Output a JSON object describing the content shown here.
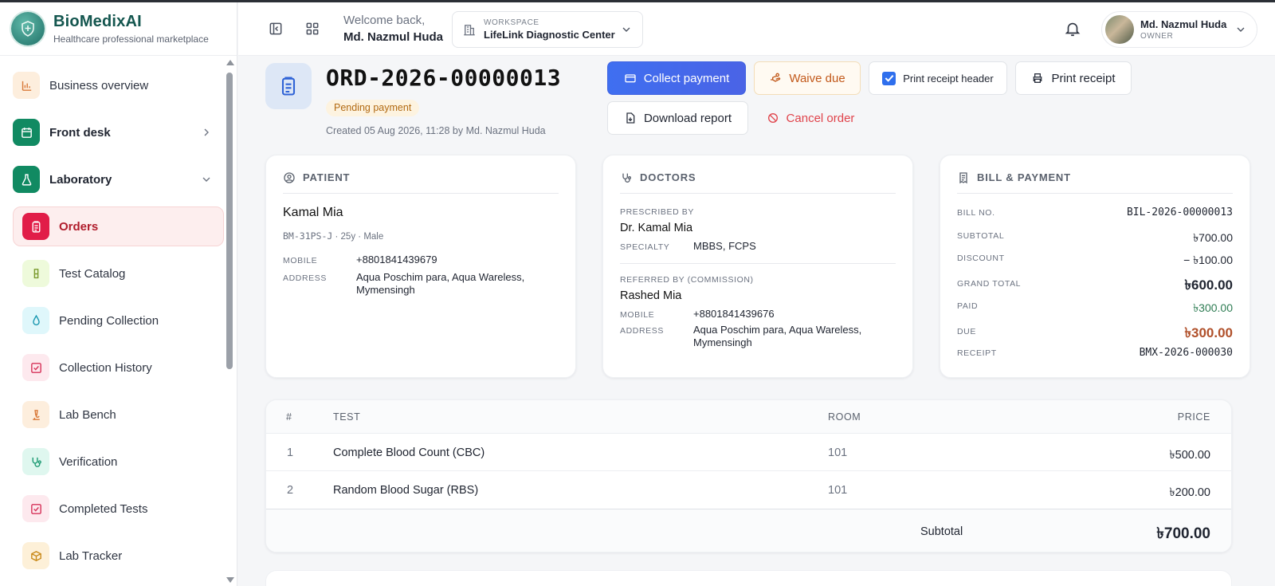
{
  "brand": {
    "title": "BioMedixAI",
    "subtitle": "Healthcare professional marketplace"
  },
  "sidebar": {
    "items": [
      {
        "label": "Business overview",
        "icon": "bar-chart-icon",
        "color": "#fdeedd"
      },
      {
        "label": "Front desk",
        "icon": "calendar-icon",
        "color": "#118a62"
      },
      {
        "label": "Laboratory",
        "icon": "flask-icon",
        "color": "#118a62"
      },
      {
        "label": "Orders",
        "icon": "clipboard-icon",
        "color": "#e11d48"
      },
      {
        "label": "Test Catalog",
        "icon": "test-tube-icon",
        "color": "#eefadb"
      },
      {
        "label": "Pending Collection",
        "icon": "droplet-icon",
        "color": "#dff7fb"
      },
      {
        "label": "Collection History",
        "icon": "checklist-icon",
        "color": "#fde9ee"
      },
      {
        "label": "Lab Bench",
        "icon": "microscope-icon",
        "color": "#fdeedd"
      },
      {
        "label": "Verification",
        "icon": "stethoscope-icon",
        "color": "#dff7ef"
      },
      {
        "label": "Completed Tests",
        "icon": "check-square-icon",
        "color": "#fde9ee"
      },
      {
        "label": "Lab Tracker",
        "icon": "box-icon",
        "color": "#fdf0d8"
      }
    ]
  },
  "header": {
    "welcome": "Welcome back,",
    "user_name": "Md. Nazmul Huda",
    "workspace_label": "WORKSPACE",
    "workspace_name": "LifeLink Diagnostic Center",
    "profile_name": "Md. Nazmul Huda",
    "profile_role": "OWNER"
  },
  "order": {
    "id": "ORD-2026-00000013",
    "status": "Pending payment",
    "created": "Created 05 Aug 2026, 11:28 by Md. Nazmul Huda"
  },
  "actions": {
    "collect_payment": "Collect payment",
    "waive_due": "Waive due",
    "print_header": "Print receipt header",
    "print_header_checked": true,
    "print_receipt": "Print receipt",
    "download_report": "Download report",
    "cancel_order": "Cancel order"
  },
  "patient": {
    "section": "PATIENT",
    "name": "Kamal Mia",
    "id": "BM-31PS-J",
    "age": "· 25y",
    "gender": "· Male",
    "mobile_label": "MOBILE",
    "mobile": "+8801841439679",
    "address_label": "ADDRESS",
    "address_line1": "Aqua Poschim para, Aqua Wareless,",
    "address_line2": "Mymensingh"
  },
  "doctors": {
    "section": "DOCTORS",
    "prescribed_label": "PRESCRIBED BY",
    "prescribed_name": "Dr. Kamal Mia",
    "specialty_label": "SPECIALTY",
    "specialty": "MBBS, FCPS",
    "referred_label": "REFERRED BY (COMMISSION)",
    "referred_name": "Rashed Mia",
    "mobile_label": "MOBILE",
    "mobile": "+8801841439676",
    "address_label": "ADDRESS",
    "address_line1": "Aqua Poschim para, Aqua Wareless,",
    "address_line2": "Mymensingh"
  },
  "bill": {
    "section": "BILL & PAYMENT",
    "rows": [
      {
        "label": "BILL NO.",
        "value": "BIL-2026-00000013"
      },
      {
        "label": "SUBTOTAL",
        "value": "৳700.00"
      },
      {
        "label": "DISCOUNT",
        "value": "− ৳100.00"
      },
      {
        "label": "GRAND TOTAL",
        "value": "৳600.00"
      },
      {
        "label": "PAID",
        "value": "৳300.00"
      },
      {
        "label": "DUE",
        "value": "৳300.00"
      },
      {
        "label": "RECEIPT",
        "value": "BMX-2026-000030"
      }
    ],
    "colors": {
      "paid": "#2f7d54",
      "due": "#b0502a"
    }
  },
  "tests": {
    "headers": {
      "num": "#",
      "test": "TEST",
      "room": "ROOM",
      "price": "PRICE"
    },
    "rows": [
      {
        "num": "1",
        "test": "Complete Blood Count (CBC)",
        "room": "101",
        "price": "৳500.00"
      },
      {
        "num": "2",
        "test": "Random Blood Sugar (RBS)",
        "room": "101",
        "price": "৳200.00"
      }
    ],
    "subtotal_label": "Subtotal",
    "subtotal_value": "৳700.00"
  }
}
